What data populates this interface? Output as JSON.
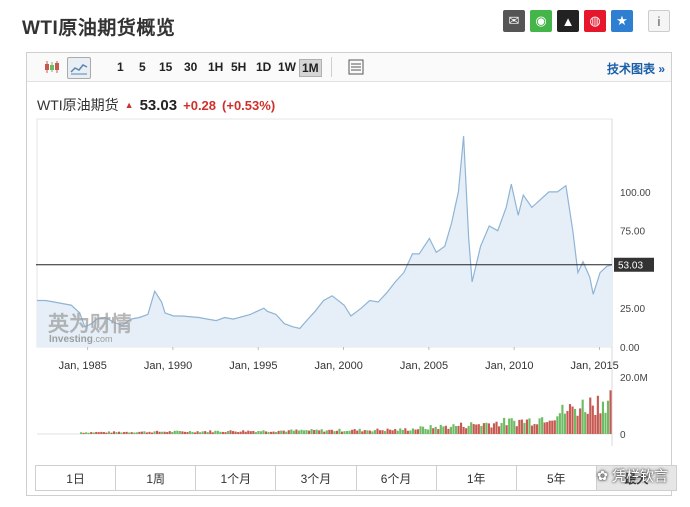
{
  "title": "WTI原油期货概览",
  "share_icons": [
    {
      "name": "mail-icon",
      "color": "#555555",
      "glyph": "✉"
    },
    {
      "name": "wechat-icon",
      "color": "#44b549",
      "glyph": "◉"
    },
    {
      "name": "qq-icon",
      "color": "#222222",
      "glyph": "▲"
    },
    {
      "name": "weibo-icon",
      "color": "#e6162d",
      "glyph": "◍"
    },
    {
      "name": "favorite-icon",
      "color": "#2e7fd1",
      "glyph": "★"
    }
  ],
  "info_glyph": "i",
  "toolbar": {
    "periods": [
      "1",
      "5",
      "15",
      "30",
      "1H",
      "5H",
      "1D",
      "1W",
      "1M"
    ],
    "active_period": "1M",
    "tech_link": "技术图表 »"
  },
  "quote": {
    "name": "WTI原油期货",
    "price": "53.03",
    "change": "+0.28",
    "change_pct": "(+0.53%)"
  },
  "ranges": [
    "1日",
    "1周",
    "1个月",
    "3个月",
    "6个月",
    "1年",
    "5年",
    "最大"
  ],
  "active_range": "最大",
  "watermark": {
    "cn": "英为财情",
    "en": "Investing",
    "suffix": ".com"
  },
  "wechat_watermark": "凭栏钦言",
  "colors": {
    "line": "#8fb4d6",
    "fill": "#e6eff7",
    "up_volume": "#6dbb63",
    "down_volume": "#c65a52",
    "price_tag": "#333333"
  },
  "chart_data": {
    "type": "area",
    "title": "",
    "xlabel": "",
    "ylabel": "",
    "x_ticks": [
      "Jan, 1985",
      "Jan, 1990",
      "Jan, 1995",
      "Jan, 2000",
      "Jan, 2005",
      "Jan, 2010",
      "Jan, 2015"
    ],
    "x_range": [
      1983.5,
      2017.2
    ],
    "y_ticks": [
      "100.00",
      "75.00",
      "25.00",
      "0.00"
    ],
    "y_tick_values": [
      100,
      75,
      25,
      0
    ],
    "y_range": [
      0,
      147
    ],
    "last_price": 53.03,
    "last_price_label": "53.03",
    "series": [
      {
        "type": "area",
        "x": [
          1983.5,
          1984,
          1984.5,
          1985,
          1985.5,
          1986,
          1986.3,
          1986.7,
          1987,
          1987.5,
          1988,
          1988.5,
          1989,
          1989.5,
          1990,
          1990.4,
          1990.8,
          1991,
          1991.5,
          1992,
          1993,
          1993.5,
          1994,
          1994.5,
          1995,
          1996,
          1996.8,
          1997,
          1997.5,
          1998,
          1998.5,
          1998.9,
          1999.3,
          1999.8,
          2000.3,
          2000.8,
          2001.5,
          2001.9,
          2002.5,
          2003,
          2003.5,
          2004,
          2004.5,
          2005,
          2005.5,
          2005.9,
          2006.5,
          2006.9,
          2007.4,
          2007.8,
          2008.2,
          2008.5,
          2008.8,
          2009,
          2009.5,
          2010,
          2010.5,
          2011,
          2011.3,
          2011.7,
          2012,
          2012.5,
          2013,
          2013.5,
          2014,
          2014.5,
          2014.9,
          2015.2,
          2015.5,
          2015.9,
          2016.1,
          2016.5,
          2016.9,
          2017.2
        ],
        "y": [
          30,
          30,
          29,
          28,
          27,
          22,
          13,
          15,
          18,
          19,
          16,
          14,
          18,
          19,
          21,
          36,
          29,
          22,
          20,
          20,
          19,
          18,
          17,
          19,
          18,
          21,
          25,
          23,
          21,
          15,
          13,
          12,
          17,
          23,
          30,
          33,
          27,
          20,
          25,
          30,
          29,
          35,
          42,
          48,
          60,
          60,
          70,
          61,
          65,
          80,
          100,
          136,
          70,
          42,
          65,
          78,
          75,
          90,
          105,
          85,
          98,
          90,
          95,
          100,
          100,
          104,
          75,
          48,
          55,
          45,
          34,
          48,
          52,
          53
        ]
      }
    ],
    "volume": {
      "y_ticks": [
        "20.0M",
        "0"
      ],
      "y_tick_values": [
        20,
        0
      ],
      "y_range": [
        0,
        20
      ],
      "unit": "M"
    }
  }
}
